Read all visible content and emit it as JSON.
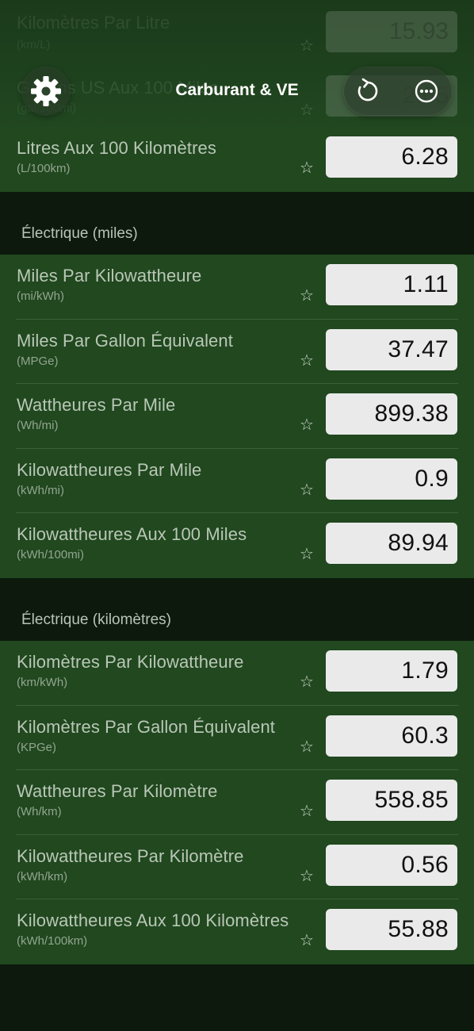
{
  "nav": {
    "title": "Carburant & VE",
    "settings_icon": "gear-icon",
    "reset_icon": "reset-icon",
    "more_icon": "ellipsis-circle-icon"
  },
  "faded_rows": [
    {
      "title": "Kilomètres Par Litre",
      "unit": "(km/L)",
      "value": "15.93"
    },
    {
      "title": "Gallons US Aux 100 Miles",
      "unit": "(gal/100mi)",
      "value": "2.65"
    }
  ],
  "fuel_group": {
    "rows": [
      {
        "title": "Litres Aux 100 Kilomètres",
        "unit": "(L/100km)",
        "value": "6.28"
      }
    ]
  },
  "electric_miles": {
    "header": "Électrique (miles)",
    "rows": [
      {
        "title": "Miles Par Kilowattheure",
        "unit": "(mi/kWh)",
        "value": "1.11"
      },
      {
        "title": "Miles Par Gallon Équivalent",
        "unit": "(MPGe)",
        "value": "37.47"
      },
      {
        "title": "Wattheures Par Mile",
        "unit": "(Wh/mi)",
        "value": "899.38"
      },
      {
        "title": "Kilowattheures Par Mile",
        "unit": "(kWh/mi)",
        "value": "0.9"
      },
      {
        "title": "Kilowattheures Aux 100 Miles",
        "unit": "(kWh/100mi)",
        "value": "89.94"
      }
    ]
  },
  "electric_km": {
    "header": "Électrique (kilomètres)",
    "rows": [
      {
        "title": "Kilomètres Par Kilowattheure",
        "unit": "(km/kWh)",
        "value": "1.79"
      },
      {
        "title": "Kilomètres Par Gallon Équivalent",
        "unit": "(KPGe)",
        "value": "60.3"
      },
      {
        "title": "Wattheures Par Kilomètre",
        "unit": "(Wh/km)",
        "value": "558.85"
      },
      {
        "title": "Kilowattheures Par Kilomètre",
        "unit": "(kWh/km)",
        "value": "0.56"
      },
      {
        "title": "Kilowattheures Aux 100 Kilomètres",
        "unit": "(kWh/100km)",
        "value": "55.88"
      }
    ]
  },
  "star_glyph": "☆",
  "colors": {
    "background": "#0d190d",
    "group": "#21481f",
    "value_box": "#eaeaea"
  }
}
